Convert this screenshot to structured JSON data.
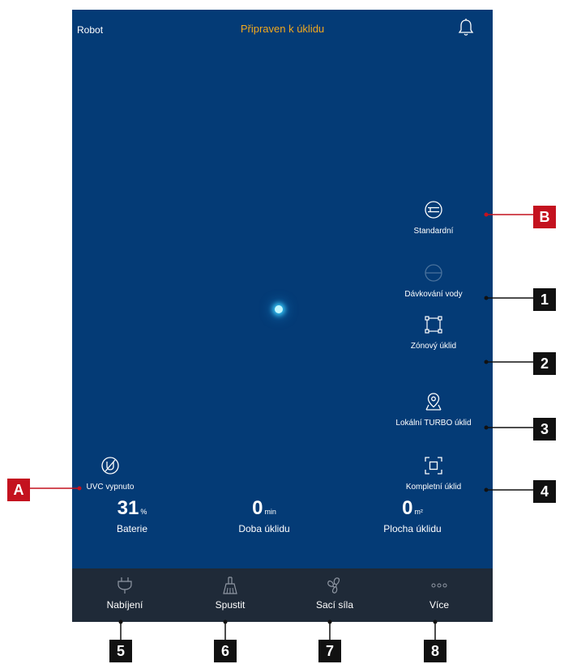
{
  "header": {
    "left_label": "Robot",
    "status_title": "Připraven k úklidu",
    "title_color": "#f2a91d"
  },
  "screen_bg": "#043b76",
  "actions": [
    {
      "label": "Standardní",
      "icon": "mode-standard-icon"
    },
    {
      "label": "Dávkování vody",
      "icon": "water-dosing-icon",
      "dimmed": true
    },
    {
      "label": "Zónový úklid",
      "icon": "zone-clean-icon"
    },
    {
      "label": "Lokální TURBO úklid",
      "icon": "location-pin-icon"
    },
    {
      "label": "Kompletní úklid",
      "icon": "full-clean-icon"
    }
  ],
  "uvc": {
    "label": "UVC vypnuto",
    "icon": "uvc-off-icon"
  },
  "stats": [
    {
      "value": "31",
      "unit": "%",
      "label": "Baterie"
    },
    {
      "value": "0",
      "unit": "min",
      "label": "Doba úklidu"
    },
    {
      "value": "0",
      "unit": "m²",
      "label": "Plocha úklidu"
    }
  ],
  "bottom_nav": [
    {
      "label": "Nabíjení",
      "icon": "plug-icon"
    },
    {
      "label": "Spustit",
      "icon": "broom-icon"
    },
    {
      "label": "Sací síla",
      "icon": "fan-icon"
    },
    {
      "label": "Více",
      "icon": "more-dots-icon"
    }
  ],
  "callouts": {
    "one": "1",
    "two": "2",
    "three": "3",
    "four": "4",
    "five": "5",
    "six": "6",
    "seven": "7",
    "eight": "8",
    "a": "A",
    "b": "B"
  },
  "callout_colors": {
    "numbered": "#111111",
    "lettered": "#c4121f"
  }
}
